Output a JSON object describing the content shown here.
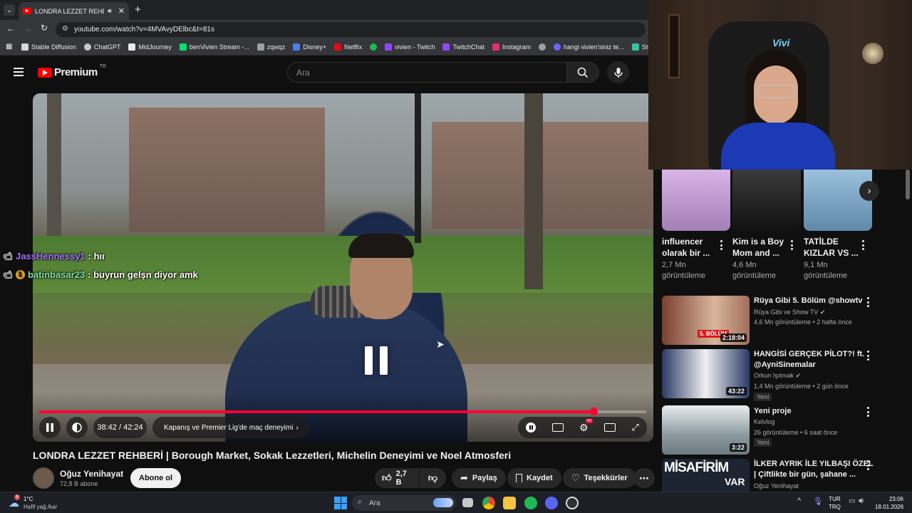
{
  "browser": {
    "tab_title": "LONDRA LEZZET REHBERİ |",
    "url": "youtube.com/watch?v=4MVAvyDElbc&t=81s",
    "bookmarks": [
      {
        "label": "Stable Diffusion",
        "color": "#d8d8d8"
      },
      {
        "label": "ChatGPT",
        "color": "#c8c8c8"
      },
      {
        "label": "MidJourney",
        "color": "#e8e8e8"
      },
      {
        "label": "benVivien Stream -...",
        "color": "#00e06a"
      },
      {
        "label": "zqwqz",
        "color": "#9aa0a6"
      },
      {
        "label": "Disney+",
        "color": "#4a7de8"
      },
      {
        "label": "Netflix",
        "color": "#e50914"
      },
      {
        "label": "",
        "color": "#1db954"
      },
      {
        "label": "vivien - Twitch",
        "color": "#9146ff"
      },
      {
        "label": "TwitchChat",
        "color": "#9146ff"
      },
      {
        "label": "Instagram",
        "color": "#e1306c"
      },
      {
        "label": "",
        "color": "#9aa0a6"
      },
      {
        "label": "hangi vivien'siniz te...",
        "color": "#6c63ff"
      },
      {
        "label": "SteamLabs",
        "color": "#31c3a2"
      }
    ]
  },
  "youtube": {
    "logo_text": "Premium",
    "logo_sup": "TR",
    "search_placeholder": "Ara",
    "accent": "#ff0033"
  },
  "player": {
    "time": "38:42 / 42:24",
    "chapter": "Kapanış ve Premier Lig'de maç deneyimi",
    "progress_fraction": 0.913,
    "state": "paused"
  },
  "chat": [
    {
      "user": "JassHennessy1",
      "message": ": hıı",
      "user_color": "#a970ff",
      "badge": ""
    },
    {
      "user": "batinbasar23",
      "message": ": buyrun gelşn diyor amk",
      "user_color": "#7ee0a6",
      "badge": "1"
    }
  ],
  "video": {
    "title": "LONDRA LEZZET REHBERİ | Borough Market, Sokak Lezzetleri, Michelin Deneyimi ve Noel Atmosferi",
    "channel": "Oğuz Yenihayat",
    "subscribers": "72,8 B abone",
    "subscribe_label": "Abone ol",
    "likes": "2,7 B",
    "share_label": "Paylaş",
    "save_label": "Kaydet",
    "thanks_label": "Teşekkürler"
  },
  "shorts": [
    {
      "title": "influencer olarak bir ...",
      "views": "2,7 Mn görüntüleme",
      "color": "#c9a6d8"
    },
    {
      "title": "Kim is a Boy Mom and ...",
      "views": "4,6 Mn görüntüleme",
      "color": "#2a2a2a"
    },
    {
      "title": "TATİLDE KIZLAR VS ...",
      "views": "9,1 Mn görüntüleme",
      "color": "#7aa7c8"
    }
  ],
  "recommendations": [
    {
      "title": "Rüya Gibi 5. Bölüm @showtv",
      "channel": "Rüya Gibi ve Show TV",
      "verified": true,
      "meta": "4,6 Mn görüntüleme • 2 hafta önce",
      "duration": "2:18:04",
      "badge": "",
      "thumb_color": "#6a3a2a"
    },
    {
      "title": "HANGİSİ GERÇEK PİLOT?! ft. @AyniSinemalar",
      "channel": "Orkun Işıtmak",
      "verified": true,
      "meta": "1,4 Mn görüntüleme • 2 gün önce",
      "duration": "43:22",
      "badge": "Yeni",
      "thumb_color": "#2c3e66"
    },
    {
      "title": "Yeni proje",
      "channel": "Kelvlog",
      "verified": false,
      "meta": "26 görüntüleme • 6 saat önce",
      "duration": "3:22",
      "badge": "Yeni",
      "thumb_color": "#b9c4c8"
    },
    {
      "title": "İLKER AYRIK İLE YILBAŞI ÖZEL | Çiftlikte bir gün, şahane ...",
      "channel": "Oğuz Yenihayat",
      "verified": false,
      "meta": "",
      "duration": "",
      "badge": "",
      "thumb_color": "#1f2a3a",
      "thumb_text": "MİSAFİRİM",
      "thumb_text2": "VAR"
    }
  ],
  "taskbar": {
    "weather_temp": "1°C",
    "weather_desc": "Hafif yağ./kar",
    "weather_badge": "8",
    "search_placeholder": "Ara",
    "lang": "TUR",
    "lang2": "TRQ",
    "time": "23:06",
    "date": "18.01.2026"
  }
}
